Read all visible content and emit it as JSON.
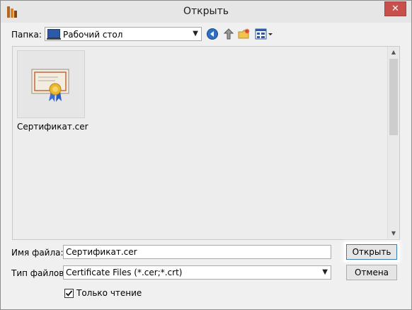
{
  "window": {
    "title": "Открыть",
    "close_glyph": "✕"
  },
  "toolbar": {
    "folder_label": "Папка:",
    "folder_value": "Рабочий стол",
    "icons": [
      "back-icon",
      "up-folder-icon",
      "new-folder-icon",
      "view-menu-icon"
    ]
  },
  "files": [
    {
      "name": "Сертификат.cer",
      "icon": "certificate-icon"
    }
  ],
  "footer": {
    "filename_label": "Имя файла:",
    "filename_value": "Сертификат.cer",
    "filetype_label": "Тип файлов:",
    "filetype_value": "Certificate Files (*.cer;*.crt)",
    "readonly_label": "Только чтение",
    "readonly_checked": true,
    "open_button": "Открыть",
    "cancel_button": "Отмена"
  },
  "colors": {
    "close_button": "#c7504c",
    "default_button_border": "#3c7fb1",
    "folder_icon": "#2a5aa8"
  }
}
